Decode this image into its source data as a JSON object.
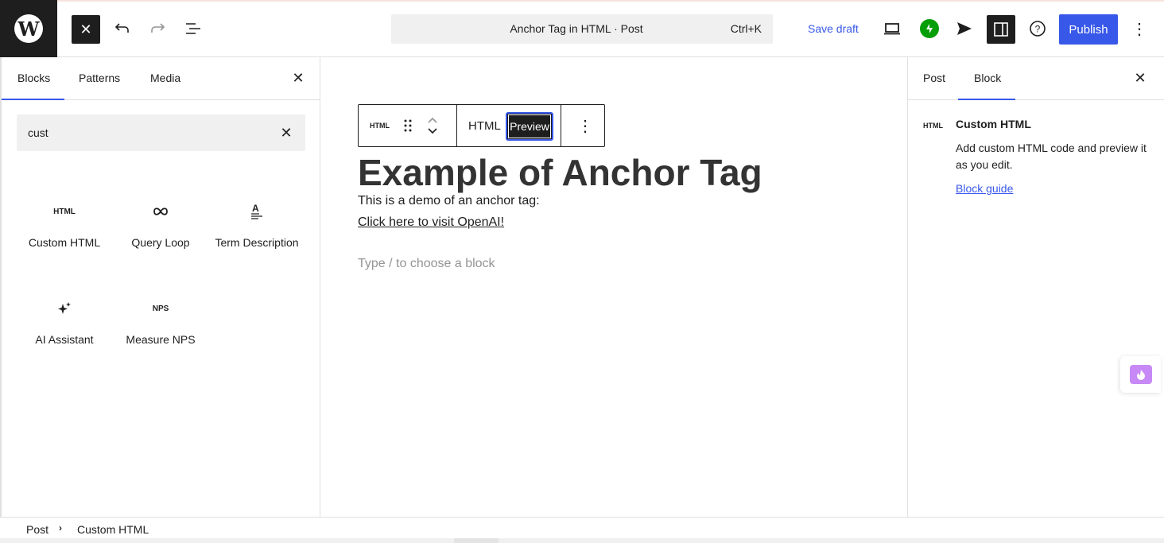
{
  "topbar": {
    "doc_title": "Anchor Tag in HTML · Post",
    "shortcut": "Ctrl+K",
    "save_draft": "Save draft",
    "publish": "Publish",
    "accent_color": "#3858e9"
  },
  "inserter": {
    "tabs": [
      "Blocks",
      "Patterns",
      "Media"
    ],
    "active_tab": "Blocks",
    "search_value": "cust",
    "blocks": [
      {
        "icon": "HTML",
        "label": "Custom HTML"
      },
      {
        "icon": "query-loop-icon",
        "label": "Query Loop"
      },
      {
        "icon": "term-description-icon",
        "label": "Term Description"
      },
      {
        "icon": "sparkles-icon",
        "label": "AI Assistant"
      },
      {
        "icon": "NPS",
        "label": "Measure NPS"
      }
    ]
  },
  "canvas": {
    "toolbar": {
      "block_type": "HTML",
      "html_tab": "HTML",
      "preview_tab": "Preview"
    },
    "heading": "Example of Anchor Tag",
    "paragraph": "This is a demo of an anchor tag:",
    "link_text": "Click here to visit OpenAI!",
    "placeholder": "Type / to choose a block"
  },
  "settings": {
    "tabs": [
      "Post",
      "Block"
    ],
    "active_tab": "Block",
    "block_icon": "HTML",
    "block_title": "Custom HTML",
    "block_description": "Add custom HTML code and preview it as you edit.",
    "block_guide": "Block guide"
  },
  "breadcrumb": [
    "Post",
    "Custom HTML"
  ]
}
